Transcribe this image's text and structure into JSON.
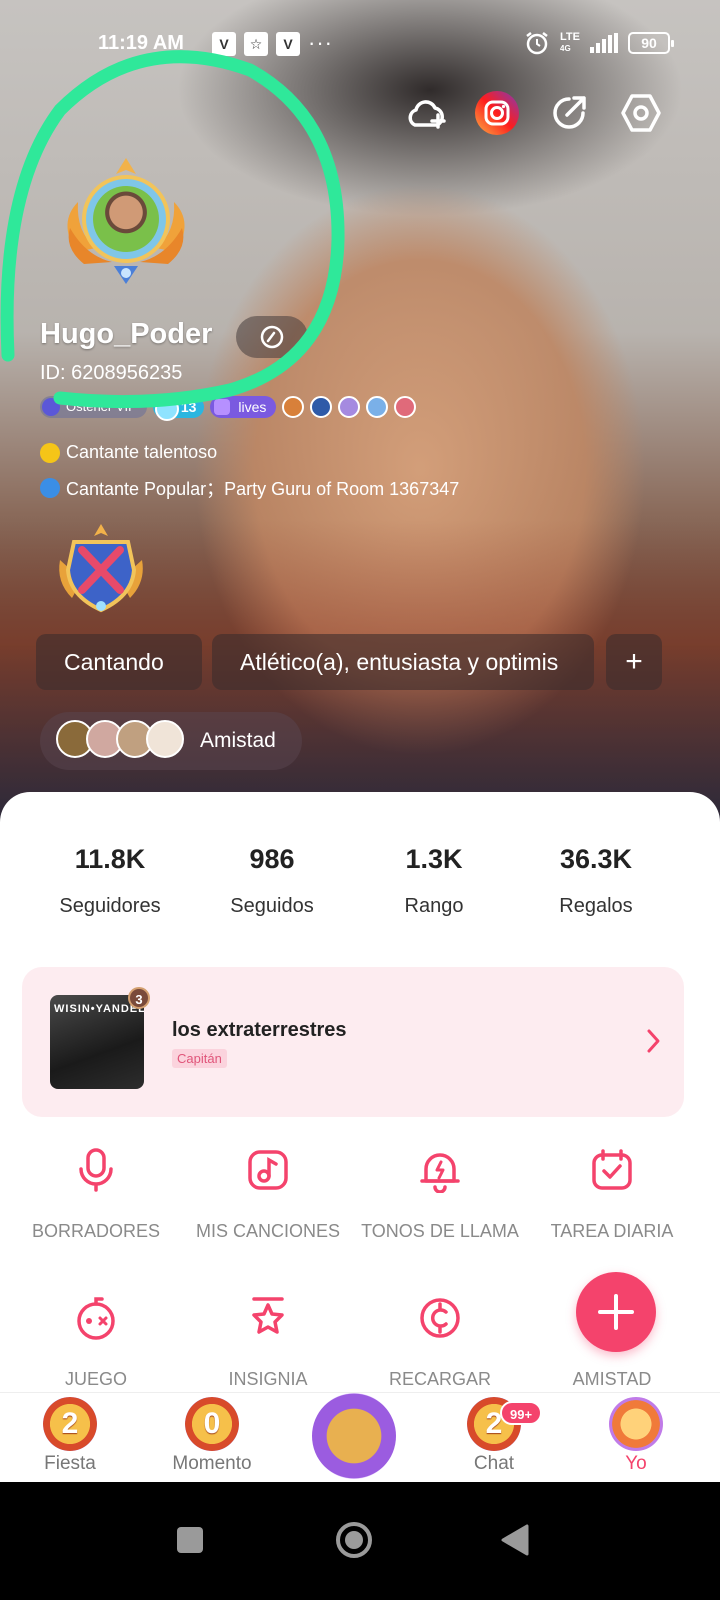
{
  "status_bar": {
    "time": "11:19 AM",
    "notification_icons": [
      "V",
      "☆",
      "V"
    ],
    "more": "···",
    "network": "LTE",
    "network_sub": "4G",
    "battery": "90"
  },
  "top_actions": [
    "add-friend-icon",
    "instagram-icon",
    "share-icon",
    "settings-icon"
  ],
  "profile": {
    "username": "Hugo_Poder",
    "user_id": "ID: 6208956235",
    "badges": {
      "vip": "Ostener VIP",
      "level": "13",
      "lives": "lives"
    },
    "tags": [
      {
        "icon": "star-icon",
        "color": "#f5c518",
        "text": "Cantante talentoso"
      },
      {
        "icon": "singer-icon",
        "color": "#3a8ee6",
        "text": "Cantante Popular；Party Guru of Room 1367347"
      }
    ],
    "chips": [
      "Cantando",
      "Atlético(a), entusiasta y optimis",
      "+"
    ],
    "friendship_label": "Amistad"
  },
  "stats": [
    {
      "value": "11.8K",
      "label": "Seguidores"
    },
    {
      "value": "986",
      "label": "Seguidos"
    },
    {
      "value": "1.3K",
      "label": "Rango"
    },
    {
      "value": "36.3K",
      "label": "Regalos"
    }
  ],
  "group": {
    "image_title": "WISIN•YANDEL",
    "count": "3",
    "name": "los extraterrestres",
    "role": "Capitán"
  },
  "menu": [
    {
      "label": "BORRADORES",
      "icon": "microphone-icon"
    },
    {
      "label": "MIS CANCIONES",
      "icon": "music-note-icon"
    },
    {
      "label": "TONOS DE LLAMA",
      "icon": "bell-icon"
    },
    {
      "label": "TAREA DIARIA",
      "icon": "calendar-check-icon"
    },
    {
      "label": "JUEGO",
      "icon": "gamepad-icon"
    },
    {
      "label": "INSIGNIA",
      "icon": "badge-icon"
    },
    {
      "label": "RECARGAR",
      "icon": "coin-icon"
    },
    {
      "label": "AMISTAD",
      "icon": "plus-icon"
    }
  ],
  "bottom_nav": [
    {
      "label": "Fiesta",
      "coin": "2"
    },
    {
      "label": "Momento",
      "coin": "0"
    },
    {
      "label": "",
      "coin": ""
    },
    {
      "label": "Chat",
      "coin": "2",
      "badge": "99+"
    },
    {
      "label": "Yo",
      "coin": "",
      "active": true
    }
  ],
  "colors": {
    "accent": "#f4436c",
    "group_card_bg": "#fdecf0",
    "menu_label": "#8a8a8a",
    "annotation": "#2fe89a"
  }
}
